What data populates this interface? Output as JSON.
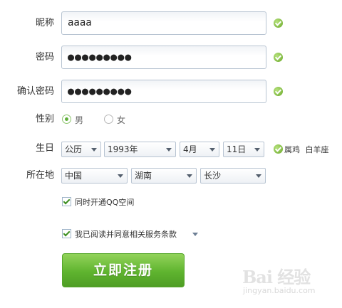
{
  "form": {
    "nickname": {
      "label": "昵称",
      "value": "aaaa"
    },
    "password": {
      "label": "密码",
      "value": "●●●●●●●●●"
    },
    "confirm_password": {
      "label": "确认密码",
      "value": "●●●●●●●●●"
    },
    "gender": {
      "label": "性别",
      "options": [
        "男",
        "女"
      ],
      "selected": "男"
    },
    "birthday": {
      "label": "生日",
      "calendar": "公历",
      "year": "1993年",
      "month": "4月",
      "day": "11日",
      "zodiac": "属鸡",
      "constellation": "白羊座"
    },
    "location": {
      "label": "所在地",
      "country": "中国",
      "province": "湖南",
      "city": "长沙"
    },
    "qzone": {
      "label": "同时开通QQ空间",
      "checked": true
    },
    "agreement": {
      "label": "我已阅读并同意相关服务条款",
      "checked": true
    },
    "submit_label": "立即注册"
  },
  "watermark": {
    "brand": "Bai 经验",
    "url": "jingyan.baidu.com"
  },
  "colors": {
    "accent": "#5fb42f",
    "valid": "#6aa829"
  },
  "icons": [
    "check-circle-icon",
    "dropdown-arrow-icon",
    "checkbox-check-icon"
  ]
}
